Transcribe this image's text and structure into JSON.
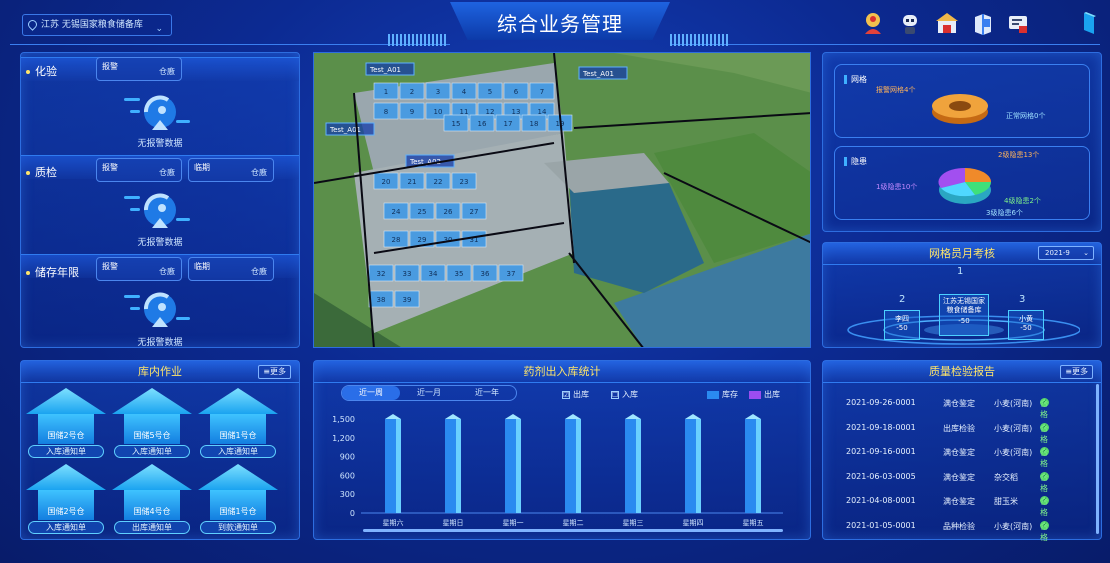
{
  "header": {
    "location": "江苏 无锡国家粮食储备库",
    "title": "综合业务管理"
  },
  "icons": [
    "police-badge-icon",
    "robot-icon",
    "warehouse-icon",
    "book-icon",
    "document-icon",
    "phone-icon"
  ],
  "left": {
    "sections": [
      {
        "label": "化验",
        "tags": [
          {
            "a": "报警",
            "b": "仓廒"
          }
        ],
        "empty": "无报警数据"
      },
      {
        "label": "质检",
        "tags": [
          {
            "a": "报警",
            "b": "仓廒"
          },
          {
            "a": "临期",
            "b": "仓廒"
          }
        ],
        "empty": "无报警数据"
      },
      {
        "label": "储存年限",
        "tags": [
          {
            "a": "报警",
            "b": "仓廒"
          },
          {
            "a": "临期",
            "b": "仓廒"
          }
        ],
        "empty": "无报警数据"
      }
    ]
  },
  "map": {
    "markers": [
      "Test_A01",
      "Test_A01",
      "Test_A01",
      "Test_A02"
    ],
    "buildings": [
      "1",
      "2",
      "3",
      "4",
      "5",
      "6",
      "7",
      "8",
      "9",
      "10",
      "11",
      "12",
      "13",
      "14",
      "15",
      "16",
      "17",
      "18",
      "19",
      "20",
      "21",
      "22",
      "23",
      "24",
      "25",
      "26",
      "27",
      "28",
      "29",
      "30",
      "31",
      "32",
      "33",
      "34",
      "35",
      "36",
      "37",
      "38",
      "39"
    ]
  },
  "warehouse_ops": {
    "title": "库内作业",
    "more": "≡更多",
    "items": [
      {
        "name": "国储2号仓",
        "button": "入库通知单"
      },
      {
        "name": "国储5号仓",
        "button": "入库通知单"
      },
      {
        "name": "国储1号仓",
        "button": "入库通知单"
      },
      {
        "name": "国储2号仓",
        "button": "入库通知单"
      },
      {
        "name": "国储4号仓",
        "button": "出库通知单"
      },
      {
        "name": "国储1号仓",
        "button": "到款通知单"
      }
    ]
  },
  "chart_panel": {
    "title": "药剂出入库统计",
    "tabs": [
      "近一周",
      "近一月",
      "近一年"
    ],
    "active_tab": 0,
    "checks": [
      {
        "label": "出库",
        "checked": "☑"
      },
      {
        "label": "入库",
        "checked": "☐"
      }
    ],
    "legend": [
      {
        "name": "库存",
        "color": "#2a8af0"
      },
      {
        "name": "出库",
        "color": "#9b4df0"
      }
    ]
  },
  "chart_data": {
    "type": "bar",
    "categories": [
      "星期六",
      "星期日",
      "星期一",
      "星期二",
      "星期三",
      "星期四",
      "星期五"
    ],
    "series": [
      {
        "name": "库存",
        "values": [
          1500,
          1500,
          1500,
          1500,
          1500,
          1500,
          1500
        ]
      }
    ],
    "yticks": [
      "1,500",
      "1,200",
      "900",
      "600",
      "300",
      "0"
    ],
    "ylim": [
      0,
      1500
    ]
  },
  "right_top": {
    "grid": {
      "label": "网格",
      "ann_alarm": "报警网格4个",
      "ann_normal": "正常网格0个"
    },
    "risk": {
      "label": "隐患",
      "ann_l2": "2级隐患13个",
      "ann_l1": "1级隐患10个",
      "ann_l4": "4级隐患2个",
      "ann_l3": "3级隐患6个"
    }
  },
  "eval": {
    "title": "网格员月考核",
    "month": "2021-9",
    "center": {
      "name": "江苏无锡国家粮食储备库",
      "score": "-50"
    },
    "left": {
      "rank": "2",
      "name": "李四",
      "score": "-50"
    },
    "right": {
      "rank": "3",
      "name": "小黄",
      "score": "-50"
    },
    "top_rank": "1"
  },
  "report": {
    "title": "质量检验报告",
    "more": "≡更多",
    "rows": [
      {
        "id": "2021-09-26-0001",
        "type": "满仓鉴定",
        "grain": "小麦(河南)",
        "result": "合格"
      },
      {
        "id": "2021-09-18-0001",
        "type": "出库检验",
        "grain": "小麦(河南)",
        "result": "合格"
      },
      {
        "id": "2021-09-16-0001",
        "type": "满仓鉴定",
        "grain": "小麦(河南)",
        "result": "合格"
      },
      {
        "id": "2021-06-03-0005",
        "type": "满仓鉴定",
        "grain": "杂交稻",
        "result": "合格"
      },
      {
        "id": "2021-04-08-0001",
        "type": "满仓鉴定",
        "grain": "甜玉米",
        "result": "合格"
      },
      {
        "id": "2021-01-05-0001",
        "type": "品种检验",
        "grain": "小麦(河南)",
        "result": "合格"
      }
    ]
  }
}
